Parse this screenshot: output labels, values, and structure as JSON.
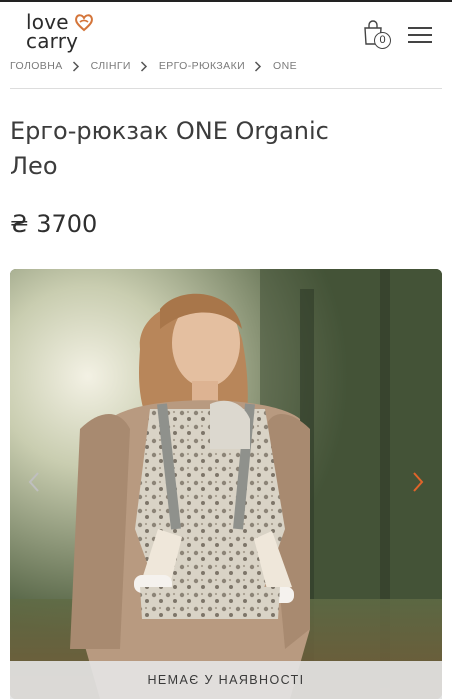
{
  "header": {
    "logo_line1": "love",
    "logo_line2": "carry",
    "cart_count": "0"
  },
  "breadcrumb": [
    {
      "label": "ГОЛОВНА"
    },
    {
      "label": "СЛІНГИ"
    },
    {
      "label": "ЕРГО-РЮКЗАКИ"
    },
    {
      "label": "ONE"
    }
  ],
  "product": {
    "title_line1": "Ерго-рюкзак ONE Organic",
    "title_line2": "Лео",
    "price": "₴ 3700",
    "availability": "НЕМАЄ У НАЯВНОСТІ"
  },
  "icons": {
    "logo": "heart-logo-icon",
    "cart": "shopping-bag-icon",
    "menu": "hamburger-menu-icon",
    "breadcrumb_separator": "chevron-right-icon",
    "gallery_prev": "chevron-left-icon",
    "gallery_next": "chevron-right-icon"
  },
  "colors": {
    "brand_accent": "#d4753a",
    "text": "#333333",
    "arrow_next": "#e0642a"
  }
}
